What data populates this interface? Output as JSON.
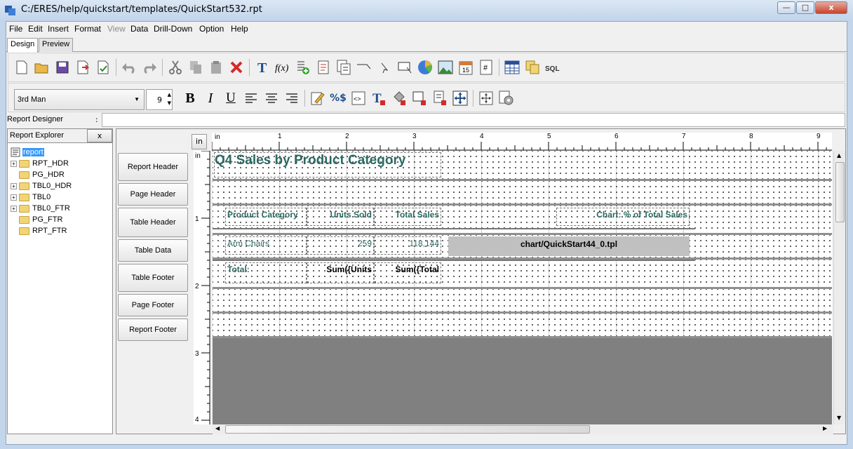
{
  "window": {
    "title": "C:/ERES/help/quickstart/templates/QuickStart532.rpt",
    "minimize": "—",
    "maximize": "□",
    "close": "x"
  },
  "menu": [
    "File",
    "Edit",
    "Insert",
    "Format",
    "View",
    "Data",
    "Drill-Down",
    "Option",
    "Help"
  ],
  "tabs": [
    "Design",
    "Preview"
  ],
  "font": {
    "family": "3rd Man",
    "size": "9"
  },
  "designer": {
    "label": "Report Designer",
    "colon": ":"
  },
  "explorer": {
    "title": "Report Explorer",
    "close": "x",
    "root": "report",
    "items": [
      "RPT_HDR",
      "PG_HDR",
      "TBL0_HDR",
      "TBL0",
      "TBL0_FTR",
      "PG_FTR",
      "RPT_FTR"
    ]
  },
  "bands": [
    "Report Header",
    "Page Header",
    "Table Header",
    "Table Data",
    "Table Footer",
    "Page Footer",
    "Report Footer"
  ],
  "ruler": {
    "unit": "in",
    "horizontal": [
      "1",
      "2",
      "3",
      "4",
      "5",
      "6",
      "7",
      "8",
      "9"
    ],
    "vertical": [
      "1",
      "2",
      "3",
      "4"
    ]
  },
  "report": {
    "title": "Q4 Sales by Product Category",
    "header": {
      "category": "Product Category",
      "units": "Units Sold",
      "sales": "Total Sales",
      "chart": "Chart: % of Total Sales"
    },
    "data": {
      "category": "Arm Chairs",
      "units": "259",
      "sales": "118,144",
      "chart": "chart/QuickStart44_0.tpl"
    },
    "footer": {
      "label": "Total:",
      "units": "Sum({Units",
      "sales": "Sum({Total"
    }
  },
  "colors": {
    "field_text": "#2c6a63",
    "canvas_bg": "#808080",
    "chart_placeholder": "#c0c0c0"
  }
}
